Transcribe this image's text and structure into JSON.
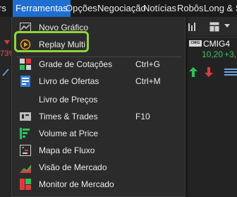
{
  "menubar": {
    "items": [
      {
        "label": "Ferramentas",
        "active": true
      },
      {
        "label": "Opções"
      },
      {
        "label": "Negociação"
      },
      {
        "label": "Notícias"
      },
      {
        "label": "Robôs"
      },
      {
        "label": "Long & Sh"
      }
    ],
    "partial_left": "rs"
  },
  "dropdown": {
    "items": [
      {
        "label": "Novo Gráfico",
        "icon": "chart-line-icon"
      },
      {
        "label": "Replay Multi",
        "icon": "replay-icon",
        "highlighted": true
      },
      {
        "label": "Grade de Cotações",
        "shortcut": "Ctrl+G",
        "icon": "quote-grid-icon"
      },
      {
        "label": "Livro de Ofertas",
        "shortcut": "Ctrl+M",
        "icon": "order-book-icon"
      },
      {
        "label": "Livro de Preços",
        "icon": "none"
      },
      {
        "label": "Times & Trades",
        "shortcut": "F10",
        "icon": "times-trades-icon"
      },
      {
        "label": "Volume at Price",
        "icon": "volume-at-price-icon"
      },
      {
        "label": "Mapa de Fluxo",
        "icon": "flow-map-icon"
      },
      {
        "label": "Visão de Mercado",
        "icon": "market-view-icon"
      },
      {
        "label": "Monitor de Mercado",
        "icon": "market-monitor-icon"
      }
    ]
  },
  "background": {
    "left_value": "73%",
    "ticker_badge": "CMIG",
    "ticker": "CMIG4",
    "price": "10,20",
    "price_change": "+3,"
  },
  "colors": {
    "menu_active": "#1f6fd1",
    "highlight": "#8dd63a",
    "positive": "#3fc35f",
    "negative": "#ff4a4a"
  }
}
